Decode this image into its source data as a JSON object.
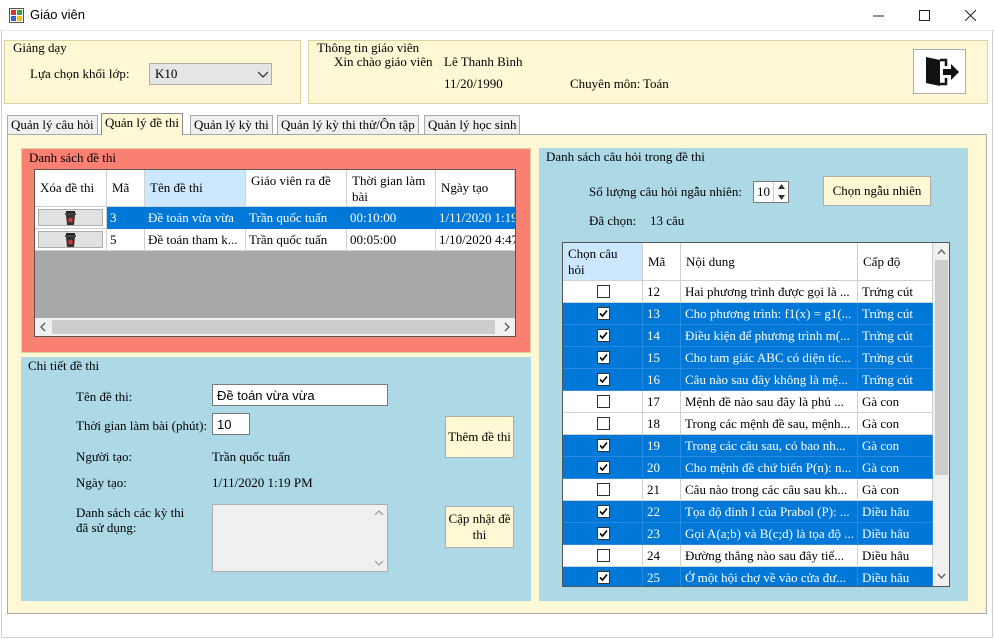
{
  "window": {
    "title": "Giáo viên"
  },
  "teaching": {
    "group_title": "Giảng dạy",
    "class_label": "Lựa chọn khối lớp:",
    "class_value": "K10"
  },
  "teacher_info": {
    "group_title": "Thông tin giáo viên",
    "greeting": "Xin chào giáo viên",
    "name": "Lê Thanh Bình",
    "dob": "11/20/1990",
    "specialty_label": "Chuyên môn:",
    "specialty_value": "Toán"
  },
  "tabs": [
    {
      "label": "Quản lý câu hỏi"
    },
    {
      "label": "Quản lý đề thi"
    },
    {
      "label": "Quản lý kỳ thi"
    },
    {
      "label": "Quản lý kỳ thi thử/Ôn tập"
    },
    {
      "label": "Quản lý học sinh"
    }
  ],
  "exam_list": {
    "title": "Danh sách đề thi",
    "columns": [
      "Xóa đề thi",
      "Mã",
      "Tên đề thi",
      "Giáo viên ra đề",
      "Thời gian làm bài",
      "Ngày tạo"
    ],
    "rows": [
      {
        "id": "3",
        "name": "Đề toán vừa vừa",
        "teacher": "Trần quốc tuấn",
        "duration": "00:10:00",
        "created": "1/11/2020 1:19"
      },
      {
        "id": "5",
        "name": "Đề toán tham k...",
        "teacher": "Trần quốc tuấn",
        "duration": "00:05:00",
        "created": "1/10/2020 4:47"
      }
    ]
  },
  "exam_detail": {
    "title": "Chi tiết đề thi",
    "name_label": "Tên đề thi:",
    "name_value": "Đề toán vừa vừa",
    "duration_label": "Thời gian làm bài (phút):",
    "duration_value": "10",
    "creator_label": "Người tạo:",
    "creator_value": "Trần quốc tuấn",
    "date_label": "Ngày tạo:",
    "date_value": "1/11/2020 1:19 PM",
    "used_label": "Danh sách các kỳ thi đã sử dụng:",
    "add_button": "Thêm đề thi",
    "update_button": "Cập nhật đề thi"
  },
  "question_list": {
    "title": "Danh sách câu hỏi trong đề thi",
    "random_label": "Số lượng câu hỏi ngẫu nhiên:",
    "random_value": "10",
    "random_button": "Chọn ngẫu nhiên",
    "selected_label": "Đã chọn:",
    "selected_value": "13 câu",
    "columns": [
      "Chọn câu hỏi",
      "Mã",
      "Nội dung",
      "Cấp độ"
    ],
    "rows": [
      {
        "checked": false,
        "id": "12",
        "content": "Hai phương trình được gọi là ...",
        "level": "Trứng cút"
      },
      {
        "checked": true,
        "id": "13",
        "content": "Cho phương trình:  f1(x) = g1(...",
        "level": "Trứng cút"
      },
      {
        "checked": true,
        "id": "14",
        "content": "Điều kiện để phương trình m(...",
        "level": "Trứng cút"
      },
      {
        "checked": true,
        "id": "15",
        "content": "Cho tam giác ABC có diện tíc...",
        "level": "Trứng cút"
      },
      {
        "checked": true,
        "id": "16",
        "content": "Câu nào sau đây không là mệ...",
        "level": "Trứng cút"
      },
      {
        "checked": false,
        "id": "17",
        "content": "Mệnh đề nào sau đây là phủ ...",
        "level": "Gà con"
      },
      {
        "checked": false,
        "id": "18",
        "content": "Trong các mệnh đề sau, mệnh...",
        "level": "Gà con"
      },
      {
        "checked": true,
        "id": "19",
        "content": "Trong các câu sau, có bao nh...",
        "level": "Gà con"
      },
      {
        "checked": true,
        "id": "20",
        "content": "Cho mệnh đề chứ biến P(n): n...",
        "level": "Gà con"
      },
      {
        "checked": false,
        "id": "21",
        "content": "Câu nào trong các câu sau kh...",
        "level": "Gà con"
      },
      {
        "checked": true,
        "id": "22",
        "content": "Tọa độ đỉnh I của Prabol (P): ...",
        "level": "Diều hâu"
      },
      {
        "checked": true,
        "id": "23",
        "content": "Gọi A(a;b) và B(c;d) là tọa độ ...",
        "level": "Diều hâu"
      },
      {
        "checked": false,
        "id": "24",
        "content": "Đường thẳng nào sau đây tiế...",
        "level": "Diều hâu"
      },
      {
        "checked": true,
        "id": "25",
        "content": "Ở một hội chợ về vào cửa đư...",
        "level": "Diều hâu"
      }
    ]
  },
  "colors": {
    "selection": "#0078d7",
    "panel_cyan": "#add8e6",
    "panel_salmon": "#fa8072",
    "panel_yellow": "#fff8d4"
  }
}
